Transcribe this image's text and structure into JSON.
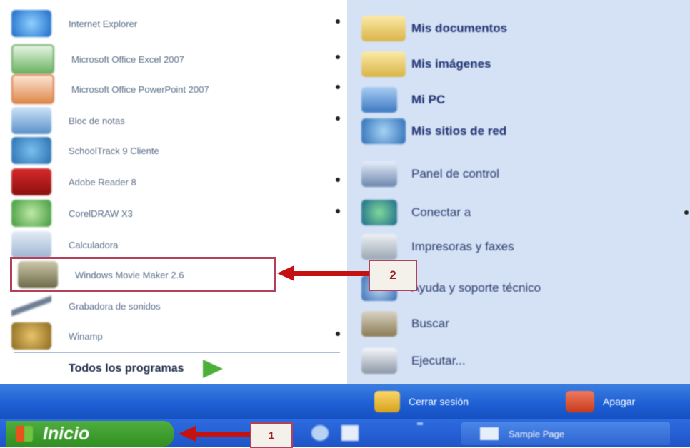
{
  "programs": [
    {
      "label": "Internet Explorer",
      "arrow": true,
      "icon": "internet-explorer-icon"
    },
    {
      "label": "Microsoft Office Excel 2007",
      "arrow": true,
      "icon": "excel-icon"
    },
    {
      "label": "Microsoft Office PowerPoint 2007",
      "arrow": true,
      "icon": "powerpoint-icon"
    },
    {
      "label": "Bloc de notas",
      "arrow": true,
      "icon": "notepad-icon"
    },
    {
      "label": "SchoolTrack 9 Cliente",
      "arrow": false,
      "icon": "schooltrack-icon"
    },
    {
      "label": "Adobe Reader 8",
      "arrow": true,
      "icon": "adobe-reader-icon"
    },
    {
      "label": "CorelDRAW X3",
      "arrow": true,
      "icon": "coreldraw-icon"
    },
    {
      "label": "Calculadora",
      "arrow": false,
      "icon": "calculator-icon"
    },
    {
      "label": "Windows Movie Maker 2.6",
      "arrow": false,
      "icon": "movie-maker-icon"
    },
    {
      "label": "Grabadora de sonidos",
      "arrow": false,
      "icon": "sound-recorder-icon"
    },
    {
      "label": "Winamp",
      "arrow": true,
      "icon": "winamp-icon"
    }
  ],
  "all_programs_label": "Todos los programas",
  "places": [
    {
      "label": "Mis documentos",
      "icon": "folder-icon"
    },
    {
      "label": "Mis imágenes",
      "icon": "pictures-folder-icon"
    },
    {
      "label": "Mi PC",
      "icon": "my-computer-icon"
    },
    {
      "label": "Mis sitios de red",
      "icon": "network-places-icon"
    }
  ],
  "system": [
    {
      "label": "Panel de control",
      "icon": "control-panel-icon"
    },
    {
      "label": "Conectar a",
      "icon": "connect-icon",
      "arrow": true
    },
    {
      "label": "Impresoras y faxes",
      "icon": "printer-icon"
    },
    {
      "label": "Ayuda y soporte técnico",
      "icon": "help-icon"
    },
    {
      "label": "Buscar",
      "icon": "search-icon"
    },
    {
      "label": "Ejecutar...",
      "icon": "run-icon"
    }
  ],
  "logoff_label": "Cerrar sesión",
  "shutdown_label": "Apagar",
  "start_label": "Inicio",
  "taskbar_window_label": "Sample Page",
  "callouts": {
    "one": "1",
    "two": "2"
  },
  "colors": {
    "highlight": "#b5405a",
    "arrow": "#c41212",
    "start_green": "#318f23",
    "taskbar_blue": "#1f55c8"
  }
}
